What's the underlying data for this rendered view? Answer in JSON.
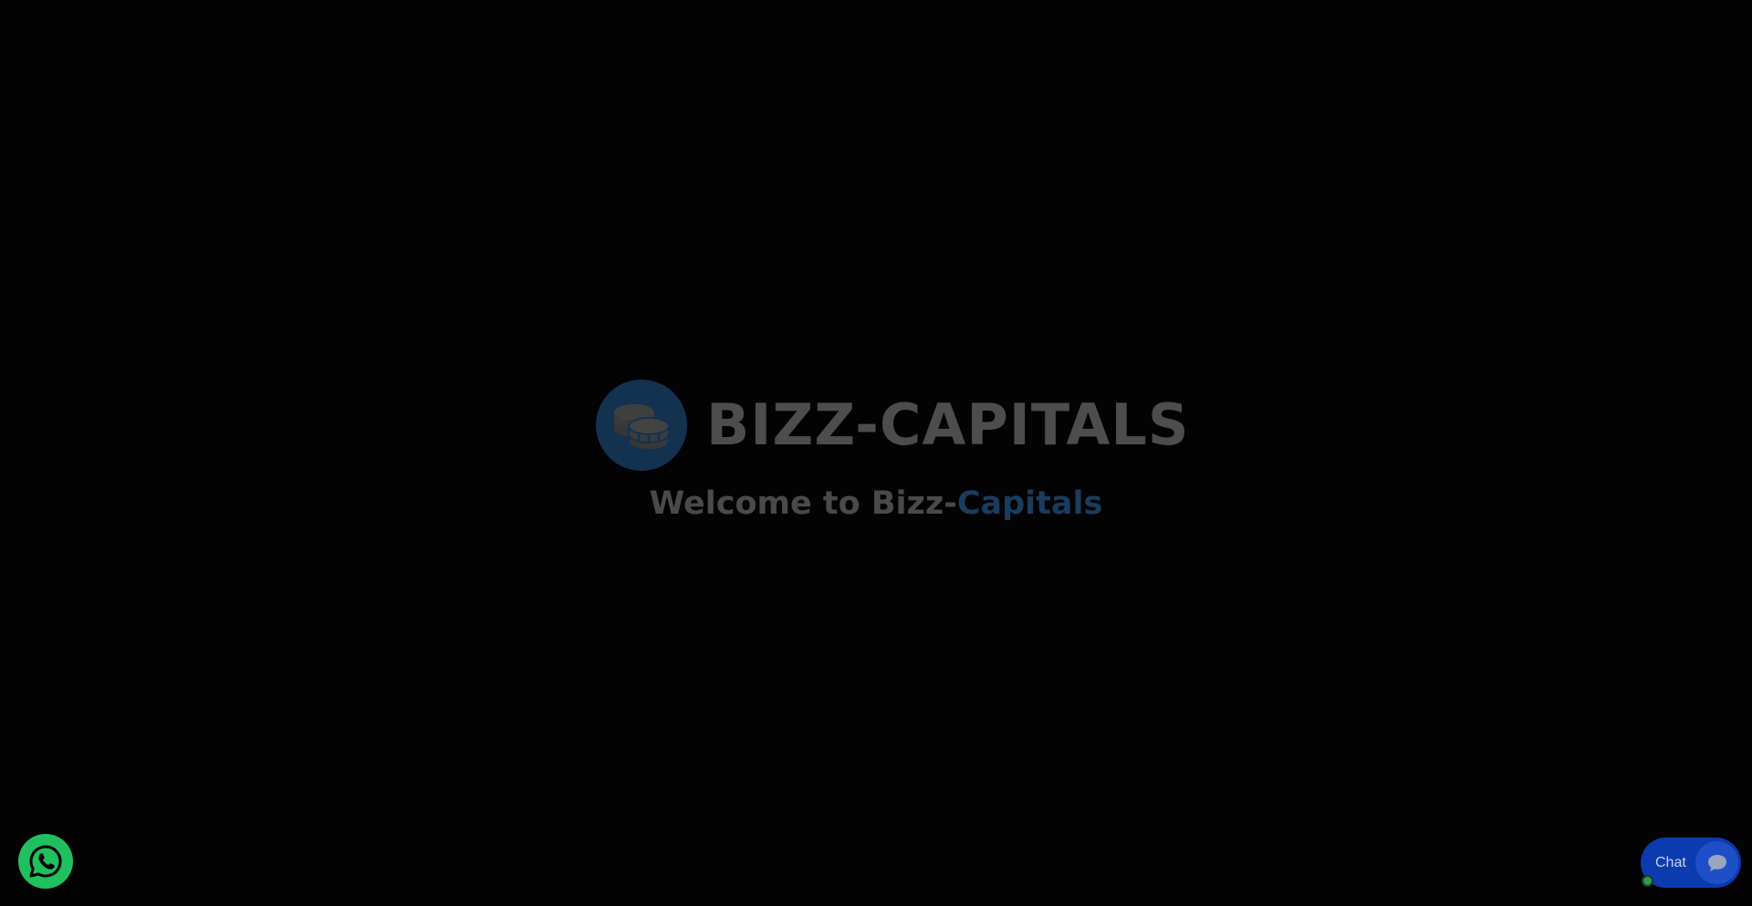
{
  "splash": {
    "brand_name": "BIZZ-CAPITALS",
    "logo_icon": "coins-icon",
    "welcome_prefix": "Welcome to Bizz-",
    "welcome_accent": "Capitals"
  },
  "widgets": {
    "whatsapp_icon": "whatsapp-icon",
    "chat_label": "Chat",
    "chat_icon": "chat-bubble-icon"
  },
  "colors": {
    "background": "#030303",
    "logo_circle": "#123250",
    "brand_text": "#4d4d4d",
    "accent_text": "#1b3c5d",
    "whatsapp_green": "#20c05f",
    "chat_blue": "#0c3bb0",
    "online_dot": "#2d9b55"
  }
}
